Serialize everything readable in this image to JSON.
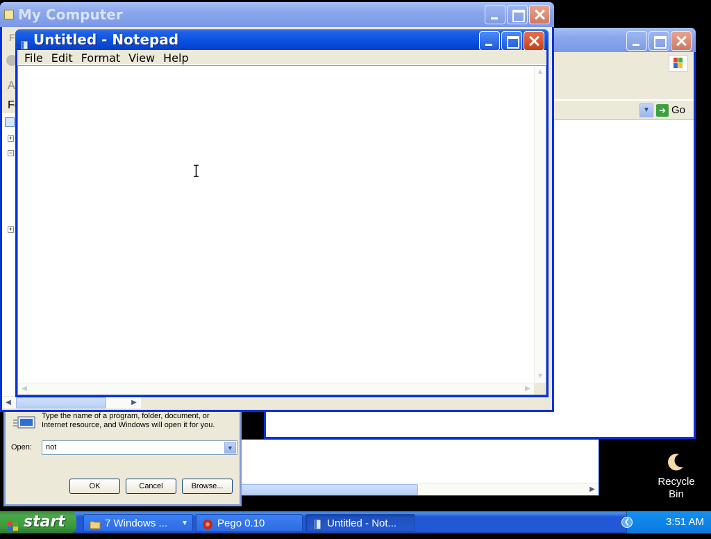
{
  "desktop": {
    "recycle_bin": {
      "line1": "Recycle",
      "line2": "Bin"
    }
  },
  "my_computer": {
    "title": "My Computer",
    "menu_initial": "F",
    "address_prefix": "Ac",
    "folders_label": "Fo",
    "go_label": "Go"
  },
  "run_dialog": {
    "description": "Type the name of a program, folder, document, or Internet resource, and Windows will open it for you.",
    "open_label": "Open:",
    "open_value": "not",
    "ok_label": "OK",
    "cancel_label": "Cancel",
    "browse_label": "Browse..."
  },
  "notepad": {
    "title": "Untitled - Notepad",
    "menu": [
      "File",
      "Edit",
      "Format",
      "View",
      "Help"
    ],
    "content": ""
  },
  "taskbar": {
    "start_label": "start",
    "tasks": [
      "7 Windows ...",
      "Pego 0.10",
      "Untitled - Not..."
    ],
    "clock": "3:51 AM"
  },
  "colors": {
    "title_active": "#0a3fc0",
    "taskbar": "#2257d5",
    "start": "#3b9a3b",
    "tray": "#0c79e0"
  }
}
